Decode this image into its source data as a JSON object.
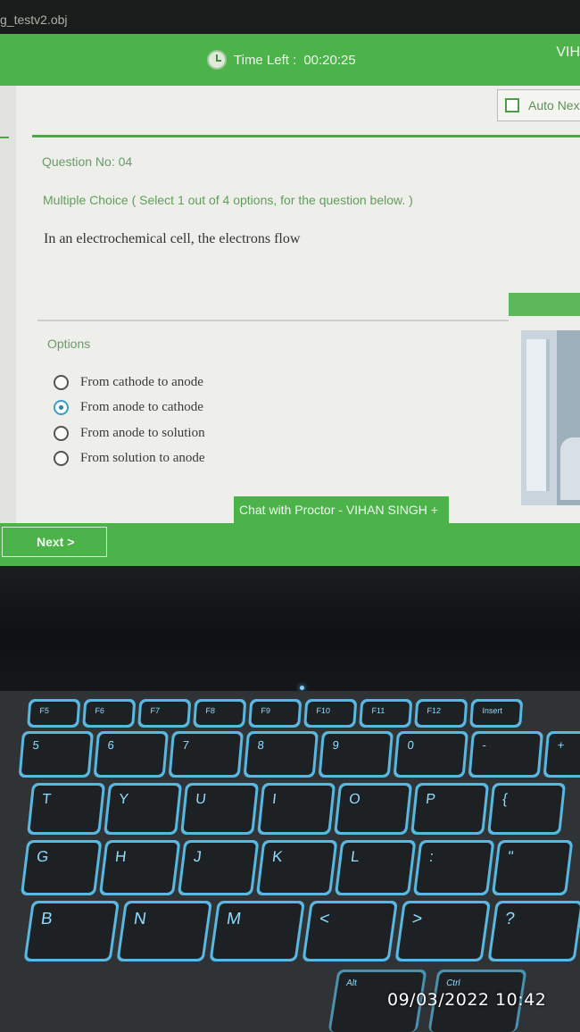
{
  "window": {
    "file_name": "g_testv2.obj"
  },
  "header": {
    "time_left_label": "Time Left :",
    "time_left_value": "00:20:25",
    "user_short": "VIH"
  },
  "auto_next": {
    "label": "Auto Nex"
  },
  "question": {
    "number_label": "Question No: 04",
    "type_label": "Multiple Choice ( Select 1 out of 4 options, for the question below. )",
    "text": "In an electrochemical cell, the electrons flow"
  },
  "options": {
    "label": "Options",
    "items": [
      {
        "text": "From cathode to anode",
        "selected": false
      },
      {
        "text": "From anode to cathode",
        "selected": true
      },
      {
        "text": "From anode to solution",
        "selected": false
      },
      {
        "text": "From solution to anode",
        "selected": false
      }
    ]
  },
  "chat": {
    "label": "Chat with Proctor - VIHAN SINGH  +"
  },
  "footer": {
    "next_label": "Next >"
  },
  "keyboard": {
    "rows": [
      [
        "F5",
        "F6",
        "F7",
        "F8",
        "F9",
        "F10",
        "F11",
        "F12",
        "Insert"
      ],
      [
        "5",
        "6",
        "7",
        "8",
        "9",
        "0",
        "-",
        "+"
      ],
      [
        "T",
        "Y",
        "U",
        "I",
        "O",
        "P",
        "{"
      ],
      [
        "G",
        "H",
        "J",
        "K",
        "L",
        ":",
        "\""
      ],
      [
        "B",
        "N",
        "M",
        "<",
        ">",
        "?"
      ]
    ],
    "alt_label": "Alt",
    "ctrl_label": "Ctrl"
  },
  "photo_timestamp": "09/03/2022 10:42",
  "colors": {
    "accent_green": "#4cb34a",
    "key_backlight": "#5fd0ff"
  }
}
